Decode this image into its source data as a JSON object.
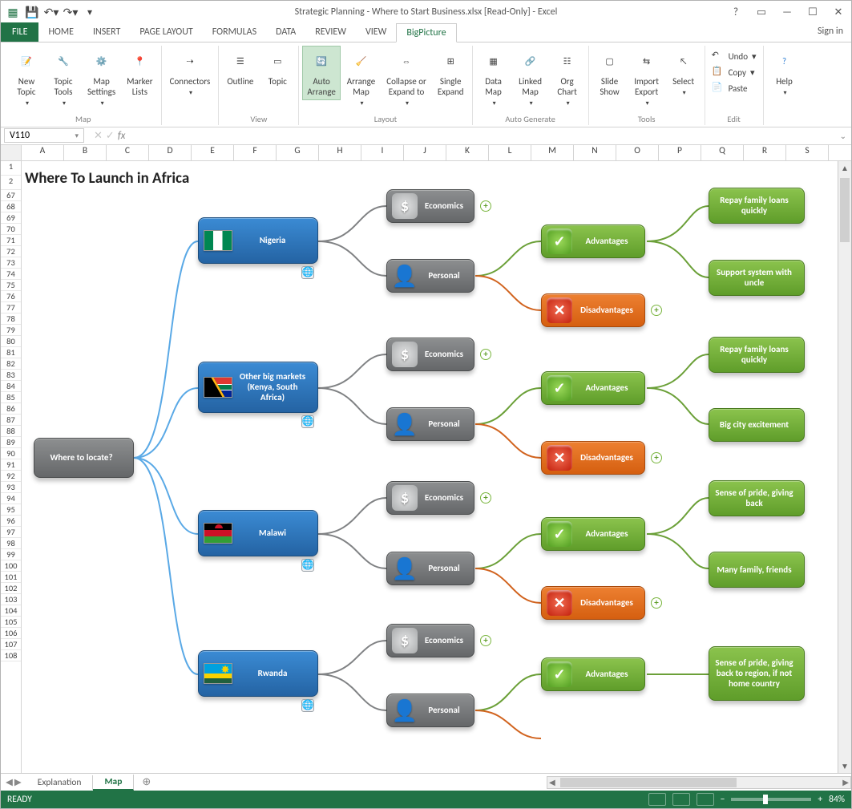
{
  "titlebar": {
    "title": "Strategic Planning - Where to Start Business.xlsx  [Read-Only] - Excel"
  },
  "tabs": {
    "file": "FILE",
    "items": [
      "HOME",
      "INSERT",
      "PAGE LAYOUT",
      "FORMULAS",
      "DATA",
      "REVIEW",
      "VIEW",
      "BigPicture"
    ],
    "active": "BigPicture",
    "signin": "Sign in"
  },
  "ribbon": {
    "groups": [
      {
        "label": "Map",
        "buttons": [
          {
            "id": "new-topic",
            "label": "New\nTopic",
            "drop": true
          },
          {
            "id": "topic-tools",
            "label": "Topic\nTools",
            "drop": true
          },
          {
            "id": "map-settings",
            "label": "Map\nSettings",
            "drop": true
          },
          {
            "id": "marker-lists",
            "label": "Marker\nLists"
          }
        ]
      },
      {
        "label": "",
        "buttons": [
          {
            "id": "connectors",
            "label": "Connectors",
            "drop": true
          }
        ]
      },
      {
        "label": "View",
        "buttons": [
          {
            "id": "outline",
            "label": "Outline"
          },
          {
            "id": "topic",
            "label": "Topic"
          }
        ]
      },
      {
        "label": "Layout",
        "buttons": [
          {
            "id": "auto-arrange",
            "label": "Auto\nArrange",
            "active": true
          },
          {
            "id": "arrange-map",
            "label": "Arrange\nMap",
            "drop": true
          },
          {
            "id": "collapse-expand",
            "label": "Collapse or\nExpand to",
            "drop": true
          },
          {
            "id": "single-expand",
            "label": "Single\nExpand"
          }
        ]
      },
      {
        "label": "Auto Generate",
        "buttons": [
          {
            "id": "data-map",
            "label": "Data\nMap",
            "drop": true
          },
          {
            "id": "linked-map",
            "label": "Linked\nMap",
            "drop": true
          },
          {
            "id": "org-chart",
            "label": "Org\nChart",
            "drop": true
          }
        ]
      },
      {
        "label": "Tools",
        "buttons": [
          {
            "id": "slide-show",
            "label": "Slide\nShow"
          },
          {
            "id": "import-export",
            "label": "Import\nExport",
            "drop": true
          },
          {
            "id": "select",
            "label": "Select",
            "drop": true
          }
        ]
      },
      {
        "label": "Edit",
        "small": [
          {
            "id": "undo",
            "label": "Undo",
            "drop": true
          },
          {
            "id": "copy",
            "label": "Copy",
            "drop": true
          },
          {
            "id": "paste",
            "label": "Paste"
          }
        ]
      },
      {
        "label": "",
        "buttons": [
          {
            "id": "help",
            "label": "Help",
            "drop": true
          }
        ]
      }
    ]
  },
  "namebox": {
    "value": "V110"
  },
  "columns": [
    "A",
    "B",
    "C",
    "D",
    "E",
    "F",
    "G",
    "H",
    "I",
    "J",
    "K",
    "L",
    "M",
    "N",
    "O",
    "P",
    "Q",
    "R",
    "S"
  ],
  "rows": [
    "1",
    "2",
    "67",
    "68",
    "69",
    "70",
    "71",
    "72",
    "73",
    "74",
    "75",
    "76",
    "77",
    "78",
    "79",
    "80",
    "81",
    "82",
    "83",
    "84",
    "85",
    "86",
    "87",
    "88",
    "89",
    "90",
    "91",
    "92",
    "93",
    "94",
    "95",
    "96",
    "97",
    "98",
    "99",
    "100",
    "101",
    "102",
    "103",
    "104",
    "105",
    "106",
    "107",
    "108"
  ],
  "heading": "Where To Launch in Africa",
  "map": {
    "root": "Where to locate?",
    "nodes": {
      "nigeria": "Nigeria",
      "other": "Other big markets (Kenya, South Africa)",
      "malawi": "Malawi",
      "rwanda": "Rwanda",
      "economics": "Economics",
      "personal": "Personal",
      "advantages": "Advantages",
      "disadvantages": "Disadvantages",
      "leaf1": "Repay family loans quickly",
      "leaf2": "Support system with uncle",
      "leaf3": "Repay family loans quickly",
      "leaf4": "Big city excitement",
      "leaf5": "Sense of pride, giving back",
      "leaf6": "Many family, friends",
      "leaf7": "Sense of pride, giving back to region, if not home country"
    }
  },
  "sheets": {
    "tabs": [
      "Explanation",
      "Map"
    ],
    "active": "Map"
  },
  "status": {
    "ready": "READY",
    "zoom": "84%"
  }
}
